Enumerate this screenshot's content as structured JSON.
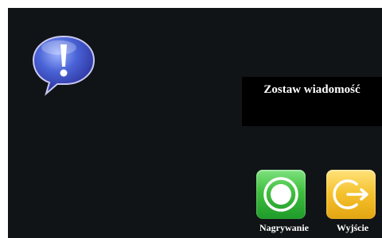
{
  "screen": {
    "title": "Zostaw wiadomość"
  },
  "icons": {
    "message": "speech-bubble-exclamation-icon",
    "record": "record-circle-icon",
    "exit": "exit-arrow-icon"
  },
  "actions": {
    "record_label": "Nagrywanie",
    "exit_label": "Wyjście"
  },
  "colors": {
    "background": "#101416",
    "title_box": "#000000",
    "record_button": "#3fbf3f",
    "exit_button": "#f4c12c",
    "message_icon": "#3c57c8"
  }
}
